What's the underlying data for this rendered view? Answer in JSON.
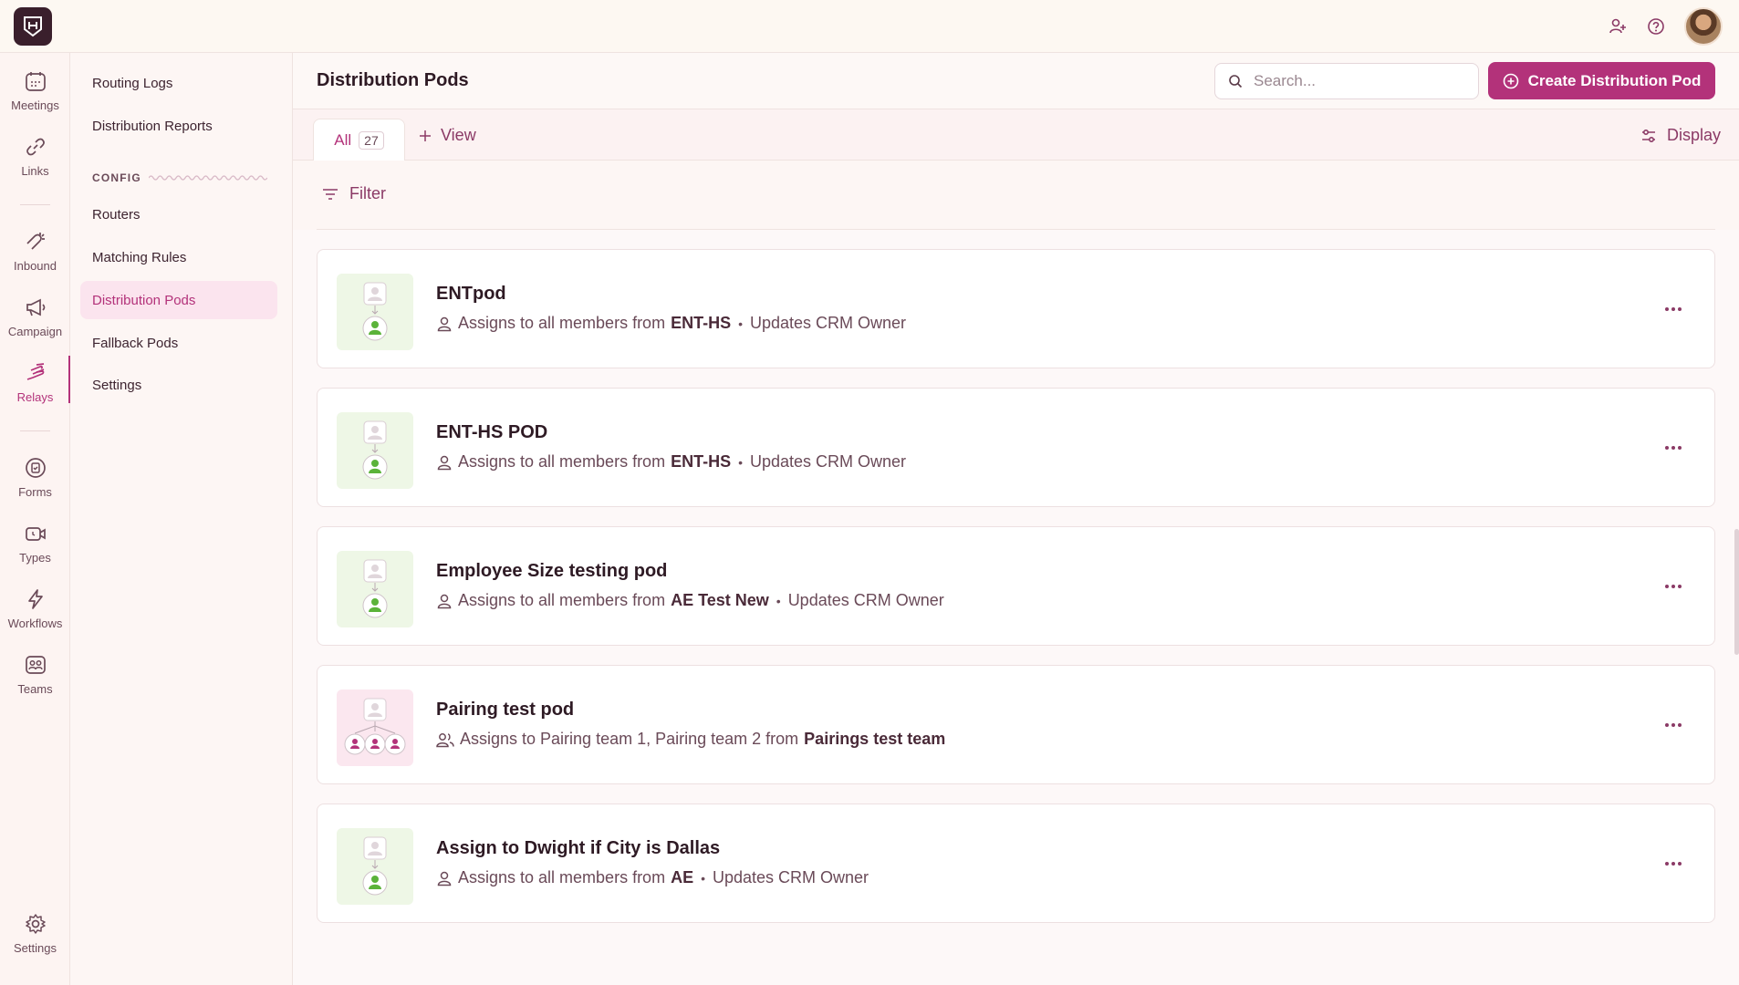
{
  "rail": {
    "items": [
      {
        "label": "Meetings",
        "icon": "calendar-icon"
      },
      {
        "label": "Links",
        "icon": "link-icon"
      },
      {
        "label": "Inbound",
        "icon": "magnet-icon"
      },
      {
        "label": "Campaign",
        "icon": "megaphone-icon"
      },
      {
        "label": "Relays",
        "icon": "relay-hand-icon"
      },
      {
        "label": "Forms",
        "icon": "form-icon"
      },
      {
        "label": "Types",
        "icon": "video-icon"
      },
      {
        "label": "Workflows",
        "icon": "lightning-icon"
      },
      {
        "label": "Teams",
        "icon": "teams-icon"
      },
      {
        "label": "Settings",
        "icon": "gear-icon"
      }
    ]
  },
  "subnav": {
    "items": [
      {
        "label": "Routing Logs"
      },
      {
        "label": "Distribution Reports"
      },
      {
        "label": "Routers"
      },
      {
        "label": "Matching Rules"
      },
      {
        "label": "Distribution Pods"
      },
      {
        "label": "Fallback Pods"
      },
      {
        "label": "Settings"
      }
    ],
    "config_label": "CONFIG"
  },
  "header": {
    "title": "Distribution Pods",
    "search_placeholder": "Search...",
    "create_label": "Create Distribution Pod"
  },
  "tabs": {
    "all_label": "All",
    "all_count": "27",
    "view_label": "View",
    "display_label": "Display"
  },
  "filter": {
    "label": "Filter"
  },
  "pods": [
    {
      "name": "ENTpod",
      "prefix": "Assigns to all members from",
      "source": "ENT-HS",
      "suffix": "Updates CRM Owner",
      "kind": "single"
    },
    {
      "name": "ENT-HS POD",
      "prefix": "Assigns to all members from",
      "source": "ENT-HS",
      "suffix": "Updates CRM Owner",
      "kind": "single"
    },
    {
      "name": "Employee Size testing pod",
      "prefix": "Assigns to all members from",
      "source": "AE Test New",
      "suffix": "Updates CRM Owner",
      "kind": "single"
    },
    {
      "name": "Pairing test pod",
      "prefix": "Assigns to Pairing team 1, Pairing team 2 from",
      "source": "Pairings test team",
      "suffix": "",
      "kind": "team"
    },
    {
      "name": "Assign to Dwight if City is Dallas",
      "prefix": "Assigns to all members from",
      "source": "AE",
      "suffix": "Updates CRM Owner",
      "kind": "single"
    }
  ],
  "colors": {
    "accent": "#b3327a",
    "sidebar_active_bg": "#fbe4ee",
    "logo_bg": "#3a1f2c"
  }
}
